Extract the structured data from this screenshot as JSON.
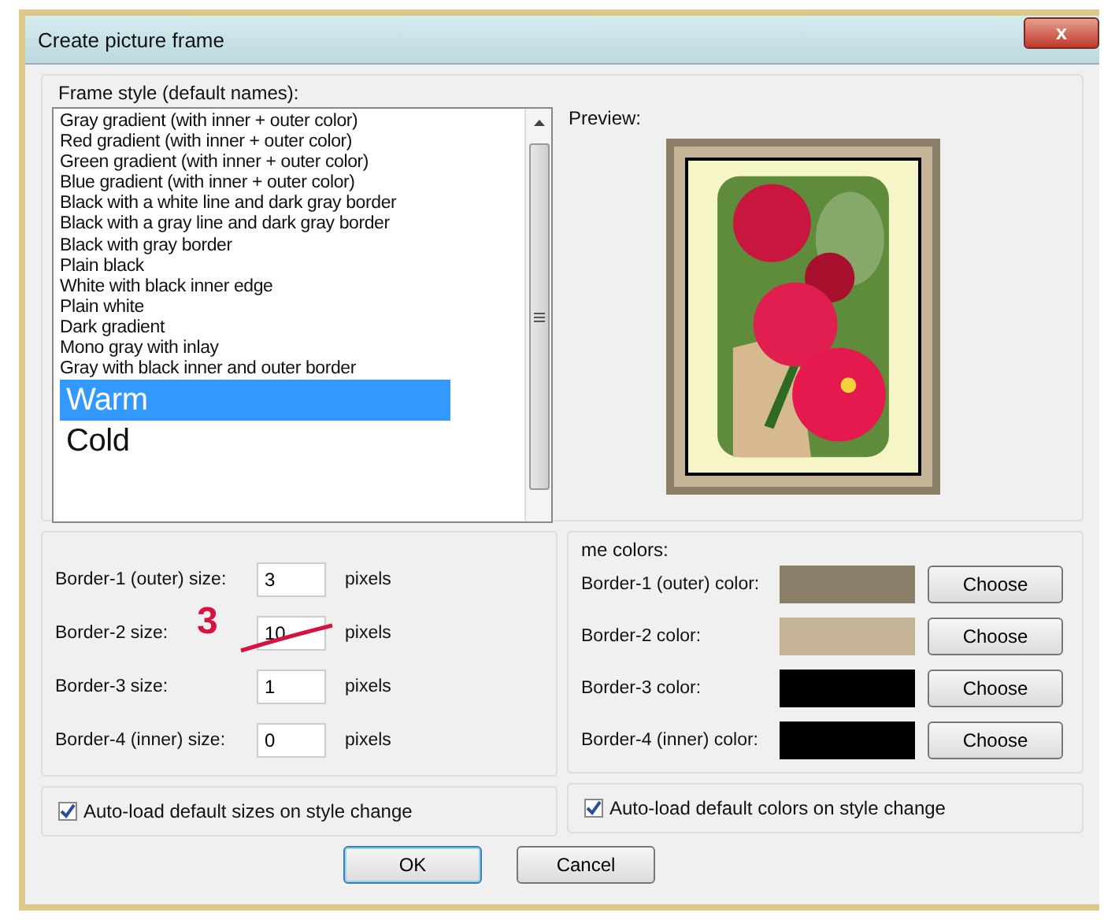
{
  "window": {
    "title": "Create picture frame",
    "close": "x"
  },
  "frame_style": {
    "label": "Frame style (default names):",
    "items": [
      {
        "label": "Gray gradient (with inner + outer color)",
        "kind": "normal",
        "selected": false
      },
      {
        "label": "Red gradient (with inner + outer color)",
        "kind": "normal",
        "selected": false
      },
      {
        "label": "Green gradient (with inner + outer color)",
        "kind": "normal",
        "selected": false
      },
      {
        "label": "Blue gradient (with inner + outer color)",
        "kind": "normal",
        "selected": false
      },
      {
        "label": "Black with a white line and dark gray border",
        "kind": "normal",
        "selected": false
      },
      {
        "label": "Black with a gray line and dark gray border",
        "kind": "normal",
        "selected": false
      },
      {
        "label": "Black with gray border",
        "kind": "normal",
        "selected": false
      },
      {
        "label": "Plain black",
        "kind": "normal",
        "selected": false
      },
      {
        "label": "White with black inner edge",
        "kind": "normal",
        "selected": false
      },
      {
        "label": "Plain white",
        "kind": "normal",
        "selected": false
      },
      {
        "label": "Dark gradient",
        "kind": "normal",
        "selected": false
      },
      {
        "label": "Mono gray with inlay",
        "kind": "normal",
        "selected": false
      },
      {
        "label": "Gray with black inner and outer border",
        "kind": "normal",
        "selected": false
      },
      {
        "label": "Warm",
        "kind": "large",
        "selected": true
      },
      {
        "label": "Cold",
        "kind": "large",
        "selected": false
      }
    ]
  },
  "preview": {
    "label": "Preview:"
  },
  "sizes": {
    "rows": [
      {
        "label": "Border-1 (outer) size:",
        "value": "3",
        "unit": "pixels",
        "struck": false
      },
      {
        "label": "Border-2 size:",
        "value": "10",
        "unit": "pixels",
        "struck": true
      },
      {
        "label": "Border-3 size:",
        "value": "1",
        "unit": "pixels",
        "struck": false
      },
      {
        "label": "Border-4 (inner) size:",
        "value": "0",
        "unit": "pixels",
        "struck": false
      }
    ],
    "autoload": {
      "label": "Auto-load default sizes on style change",
      "checked": true
    },
    "annotation": "3"
  },
  "colors": {
    "label": "me colors:",
    "rows": [
      {
        "label": "Border-1 (outer) color:",
        "color": "#8b7e68",
        "button": "Choose"
      },
      {
        "label": "Border-2 color:",
        "color": "#c4b397",
        "button": "Choose"
      },
      {
        "label": "Border-3 color:",
        "color": "#000000",
        "button": "Choose"
      },
      {
        "label": "Border-4 (inner) color:",
        "color": "#000000",
        "button": "Choose"
      }
    ],
    "autoload": {
      "label": "Auto-load default colors on style change",
      "checked": true
    }
  },
  "buttons": [
    {
      "label": "OK",
      "default": true
    },
    {
      "label": "Cancel",
      "default": false
    }
  ]
}
